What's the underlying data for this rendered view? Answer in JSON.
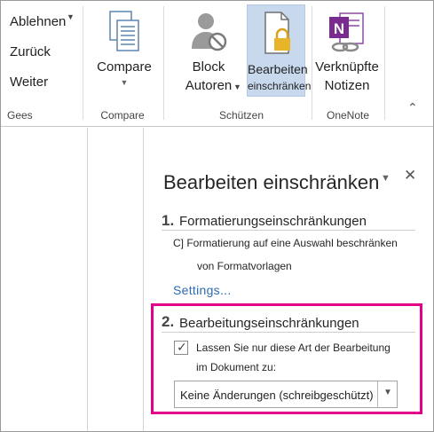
{
  "ribbon": {
    "small_buttons": {
      "reject": "Ablehnen",
      "back": "Zurück",
      "next": "Weiter"
    },
    "groups": {
      "changes_label": "Gees",
      "compare_label": "Compare",
      "protect_label": "Schützen",
      "onenote_label": "OneNote"
    },
    "buttons": {
      "compare": "Compare",
      "block_line1": "Block",
      "block_line2": "Autoren",
      "restrict_line1": "Bearbeiten",
      "restrict_line2": "einschränken",
      "linked_line1": "Verknüpfte",
      "linked_line2": "Notizen"
    },
    "collapse_glyph": "⌃"
  },
  "pane": {
    "title": "Bearbeiten einschränken",
    "close_glyph": "✕",
    "dropdown_glyph": "▼",
    "section1": {
      "number": "1.",
      "heading": "Formatierungseinschränkungen",
      "line1": "C] Formatierung auf eine Auswahl beschränken",
      "line2": "von Formatvorlagen",
      "settings": "Settings..."
    },
    "section2": {
      "number": "2.",
      "heading": "Bearbeitungseinschränkungen",
      "checkbox_line1": "Lassen Sie nur diese Art der Bearbeitung",
      "checkbox_line2": "im Dokument zu:",
      "checked": true,
      "select_value": "Keine Änderungen (schreibgeschützt)"
    }
  },
  "colors": {
    "highlight_border": "#e2008a",
    "selected_button_bg": "#c8d9ee",
    "link": "#2b6cb0",
    "onenote_purple": "#7b2a8f"
  }
}
